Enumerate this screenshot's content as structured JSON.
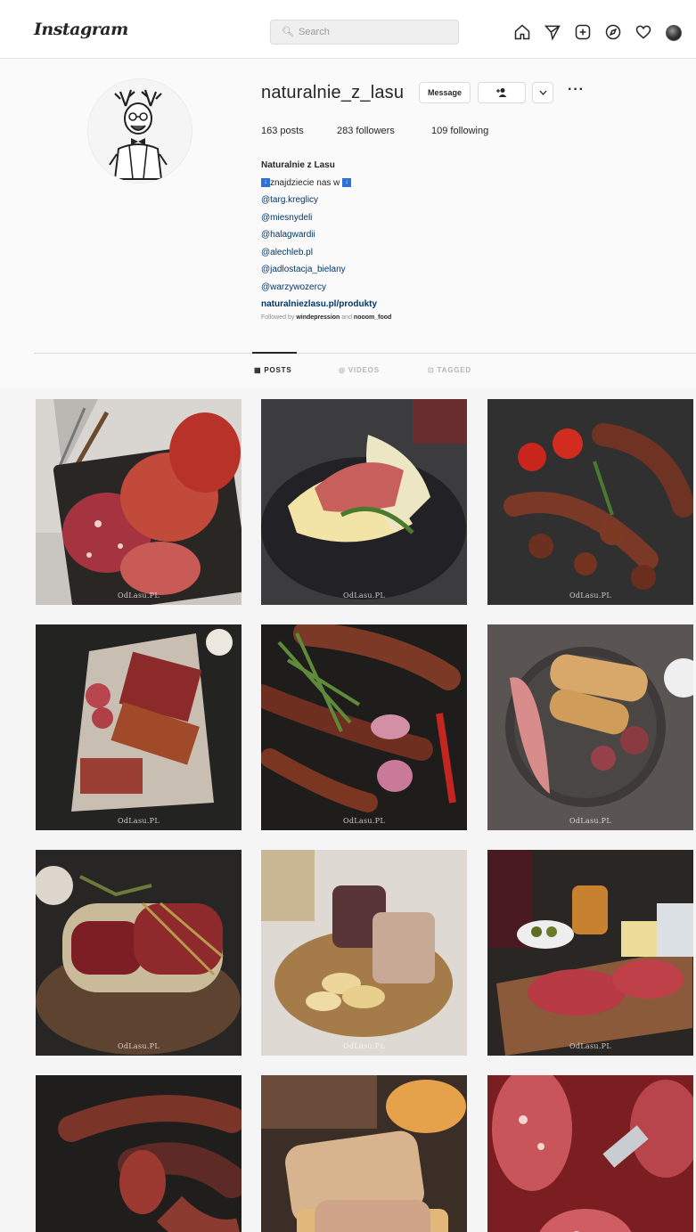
{
  "header": {
    "logo": "Instagram",
    "search_placeholder": "Search",
    "icons": [
      "home-icon",
      "direct-icon",
      "new-post-icon",
      "explore-icon",
      "activity-icon",
      "profile-avatar"
    ]
  },
  "profile": {
    "username": "naturalnie_z_lasu",
    "buttons": {
      "message": "Message"
    },
    "stats": {
      "posts": "163 posts",
      "followers": "283 followers",
      "following": "109 following"
    },
    "bio": {
      "name": "Naturalnie z Lasu",
      "line1": "znajdziecie nas w",
      "tags": [
        "@targ.kreglicy",
        "@miesnydeli",
        "@halagwardii",
        "@alechleb.pl",
        "@jadlostacja_bielany",
        "@warzywozercy"
      ],
      "link": "naturalniezlasu.pl/produkty"
    },
    "followed_by": {
      "prefix": "Followed by",
      "user1": "windepression",
      "and": "and",
      "user2": "nooom_food"
    }
  },
  "tabs": [
    {
      "label": "POSTS",
      "active": true
    },
    {
      "label": "VIDEOS",
      "active": false
    },
    {
      "label": "TAGGED",
      "active": false
    }
  ],
  "watermark": "OdLasu.PL",
  "posts": [
    {
      "subject": "cured meat board with forks"
    },
    {
      "subject": "melon wrapped in prosciutto"
    },
    {
      "subject": "sausages with tomatoes"
    },
    {
      "subject": "cured meats with garlic"
    },
    {
      "subject": "sausages with rosemary and chili"
    },
    {
      "subject": "prosciutto with bread and figs"
    },
    {
      "subject": "smoked meat on wooden board"
    },
    {
      "subject": "pate jars with crackers"
    },
    {
      "subject": "charcuterie and cheese board"
    },
    {
      "subject": "dry sausages sliced"
    },
    {
      "subject": "pate on bread"
    },
    {
      "subject": "salami slices"
    }
  ],
  "colors": {
    "link": "#00376b",
    "text": "#262626",
    "muted": "#8e8e8e",
    "accent_square": "#2f6fd6"
  }
}
